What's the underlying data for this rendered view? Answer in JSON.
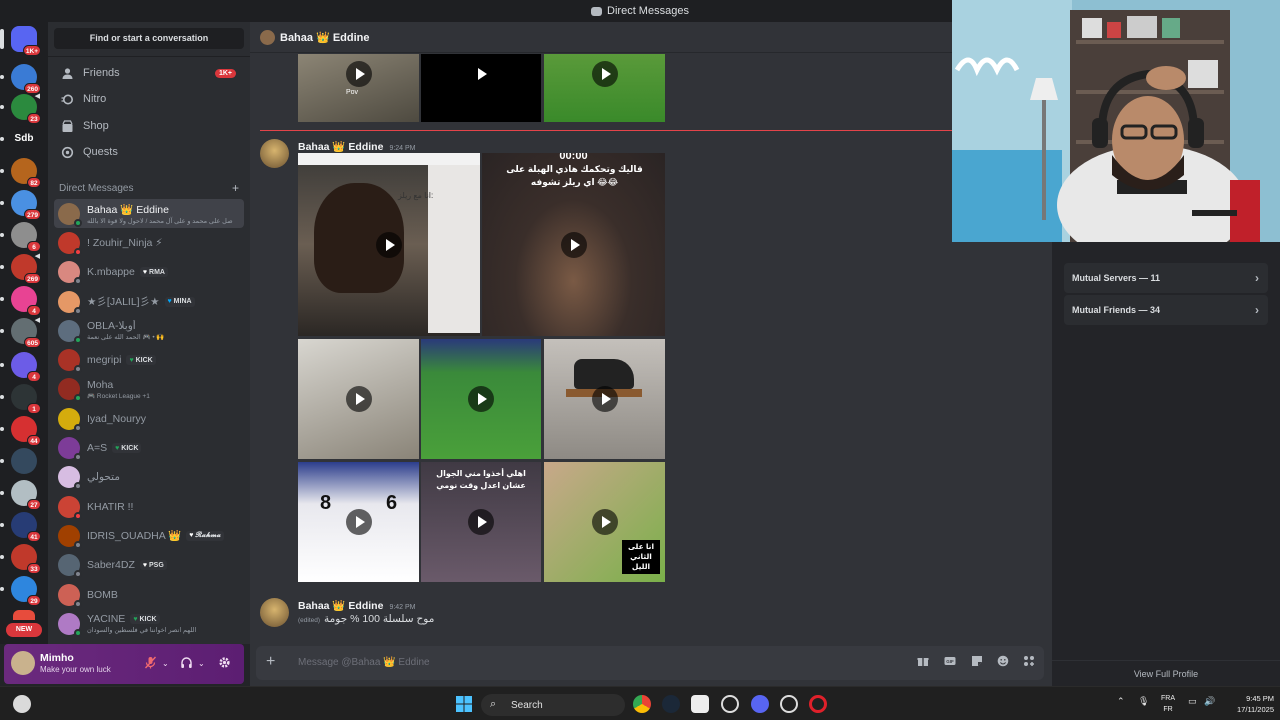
{
  "window": {
    "title": "Direct Messages"
  },
  "servers": [
    {
      "badge": "1K+",
      "color": "#5865f2"
    },
    {
      "badge": "260",
      "color": "#3a7bd5"
    },
    {
      "badge": "23",
      "color": "#2b8a3e"
    },
    {
      "label": "Sdb"
    },
    {
      "badge": "82",
      "color": "#b5651d"
    },
    {
      "badge": "279",
      "color": "#4a90e2"
    },
    {
      "badge": "6",
      "color": "#8e8e8e"
    },
    {
      "badge": "269",
      "color": "#c0392b"
    },
    {
      "badge": "4",
      "color": "#e84393"
    },
    {
      "badge": "605",
      "color": "#636e72"
    },
    {
      "badge": "4",
      "color": "#6c5ce7"
    },
    {
      "badge": "1",
      "color": "#2d3436"
    },
    {
      "badge": "44",
      "color": "#d63031"
    },
    {
      "badge": "",
      "color": "#34495e"
    },
    {
      "badge": "27",
      "color": "#b2bec3"
    },
    {
      "badge": "41",
      "color": "#273c75"
    },
    {
      "badge": "33",
      "color": "#c0392b"
    },
    {
      "badge": "29",
      "color": "#2e86de"
    }
  ],
  "rail_new": "NEW",
  "sidebar": {
    "search_label": "Find or start a conversation",
    "nav": [
      {
        "label": "Friends",
        "icon": "friends-icon",
        "badge": "1K+"
      },
      {
        "label": "Nitro",
        "icon": "nitro-icon",
        "badge": ""
      },
      {
        "label": "Shop",
        "icon": "shop-icon",
        "badge": ""
      },
      {
        "label": "Quests",
        "icon": "quests-icon",
        "badge": ""
      }
    ],
    "dm_header": "Direct Messages",
    "dm_add": "+",
    "dms": [
      {
        "name": "Bahaa 👑 Eddine",
        "sub": "صل على محمد و على آل محمد / لاحول ولا قوة الا بالله",
        "tag": "",
        "status": "on",
        "active": true,
        "color": "#8a6a4b"
      },
      {
        "name": "! Zouhir_Ninja ⚡",
        "sub": "",
        "tag": "",
        "status": "dnd",
        "color": "#c0392b"
      },
      {
        "name": "K.mbappe",
        "sub": "",
        "tag": "RMA",
        "tagheart": "w",
        "status": "off",
        "color": "#d98880"
      },
      {
        "name": "★彡[JALIL]彡★",
        "sub": "",
        "tag": "MINA",
        "tagheart": "b",
        "status": "off",
        "color": "#e59866"
      },
      {
        "name": "OBLA-أوبلا",
        "sub": "الحمد الله على نعمة 🎮 • 🙌",
        "tag": "",
        "status": "on",
        "color": "#5d6d7e"
      },
      {
        "name": "megripi",
        "sub": "",
        "tag": "KICK",
        "tagheart": "g",
        "status": "off",
        "color": "#a93226"
      },
      {
        "name": "Moha",
        "sub": "🎮 Rocket League +1",
        "tag": "",
        "status": "on",
        "color": "#922b21"
      },
      {
        "name": "Iyad_Nouryy",
        "sub": "",
        "tag": "",
        "status": "off",
        "color": "#d4ac0d"
      },
      {
        "name": "A=S",
        "sub": "",
        "tag": "KICK",
        "tagheart": "g",
        "status": "off",
        "color": "#7d3c98"
      },
      {
        "name": "متحولي",
        "sub": "",
        "tag": "",
        "status": "off",
        "color": "#d7bde2"
      },
      {
        "name": "KHATIR !!",
        "sub": "",
        "tag": "",
        "status": "dnd",
        "color": "#cb4335"
      },
      {
        "name": "IDRIS_OUADHA 👑",
        "sub": "",
        "tag": "𝓡𝓪𝓱𝓶𝓪",
        "tagheart": "w",
        "status": "off",
        "color": "#a04000"
      },
      {
        "name": "Saber4DZ",
        "sub": "",
        "tag": "PSG",
        "tagheart": "w",
        "status": "off",
        "color": "#566573"
      },
      {
        "name": "BOMB",
        "sub": "",
        "tag": "",
        "status": "off",
        "color": "#cd6155"
      },
      {
        "name": "YACINE",
        "sub": "اللهم انصر اخواننا في فلسطين والسودان",
        "tag": "KICK",
        "tagheart": "g",
        "status": "on",
        "color": "#af7ac5"
      }
    ]
  },
  "user": {
    "name": "Mimho",
    "status": "Make your own luck"
  },
  "chat": {
    "header_name": "Bahaa 👑 Eddine",
    "messages": [
      {
        "author": "Bahaa 👑 Eddine",
        "time": "9:24 PM"
      },
      {
        "author": "Bahaa 👑 Eddine",
        "time": "9:42 PM",
        "edited": "(edited)",
        "text": "موح سلسلة 100 % جومة"
      }
    ],
    "video_captions": {
      "v1_top": "00:00",
      "v1_text": "قاليك وتحكمك هاذي الهبلة على اي ريلز تشوفه 😂😂",
      "v_left_text": "انا مع ريلز:",
      "v_bottom_mid": "اهلي أخذوا مني الجوال عشان اعدل وقت نومي",
      "v_bottom_right": "انا على الثاني الليل",
      "v_pov": "Pov"
    },
    "composer_placeholder": "Message @Bahaa 👑 Eddine"
  },
  "profile": {
    "cards": [
      {
        "label": "Mutual Servers — 11"
      },
      {
        "label": "Mutual Friends — 34"
      }
    ],
    "view_full": "View Full Profile"
  },
  "taskbar": {
    "search": "Search",
    "lang_top": "FRA",
    "lang_bottom": "FR",
    "time": "9:45 PM",
    "date": "17/11/2025"
  }
}
